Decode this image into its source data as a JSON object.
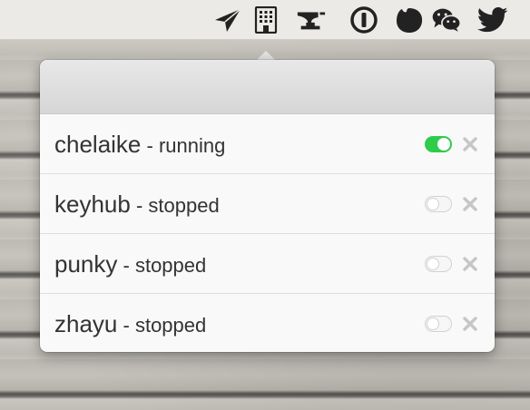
{
  "menubar": {
    "icons": [
      "send-icon",
      "building-icon",
      "anvil-icon",
      "1password-icon",
      "blob-icon",
      "wechat-icon",
      "twitter-icon"
    ]
  },
  "popover": {
    "processes": [
      {
        "name": "chelaike",
        "separator": " - ",
        "status": "running",
        "enabled": true
      },
      {
        "name": "keyhub",
        "separator": " - ",
        "status": "stopped",
        "enabled": false
      },
      {
        "name": "punky",
        "separator": " - ",
        "status": "stopped",
        "enabled": false
      },
      {
        "name": "zhayu",
        "separator": " - ",
        "status": "stopped",
        "enabled": false
      }
    ]
  },
  "colors": {
    "toggle_on": "#2ecc4a",
    "menubar_icon": "#222222",
    "close_icon": "#c6c6c6"
  }
}
